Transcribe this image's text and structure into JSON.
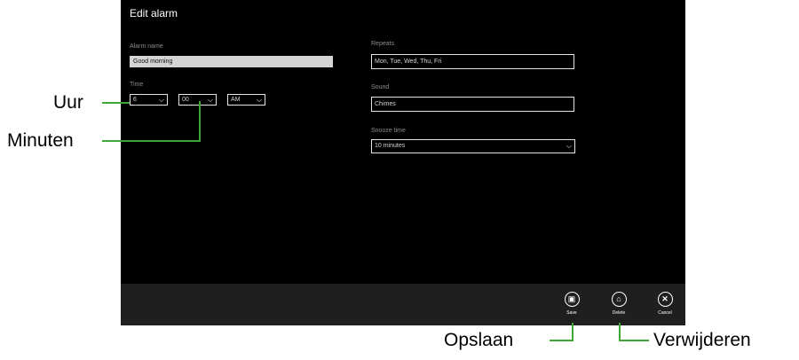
{
  "window": {
    "title": "Edit alarm"
  },
  "form": {
    "alarm_name": {
      "label": "Alarm name",
      "value": "Good morning"
    },
    "time": {
      "label": "Time",
      "hour": "6",
      "minute": "00",
      "ampm": "AM"
    },
    "repeats": {
      "label": "Repeats",
      "value": "Mon, Tue, Wed, Thu, Fri"
    },
    "sound": {
      "label": "Sound",
      "value": "Chimes"
    },
    "snooze": {
      "label": "Snooze time",
      "value": "10 minutes"
    }
  },
  "appbar": {
    "save": {
      "label": "Save",
      "icon": "save-icon"
    },
    "delete": {
      "label": "Delete",
      "icon": "trash-icon"
    },
    "cancel": {
      "label": "Cancel",
      "icon": "close-icon"
    }
  },
  "callouts": {
    "hour": "Uur",
    "minutes": "Minuten",
    "save": "Opslaan",
    "delete": "Verwijderen"
  },
  "colors": {
    "callout_line": "#3fa535",
    "screen_bg": "#000000",
    "appbar_bg": "#1f1f1f"
  }
}
